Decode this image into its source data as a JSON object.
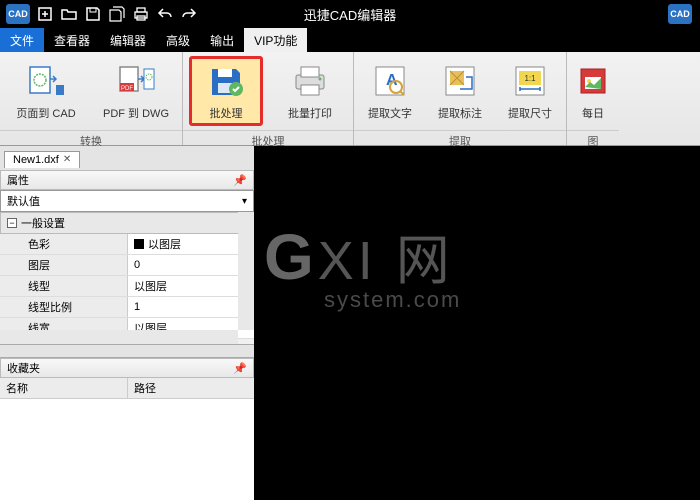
{
  "app": {
    "title": "迅捷CAD编辑器",
    "logo_text": "CAD"
  },
  "menu": {
    "items": [
      "文件",
      "查看器",
      "编辑器",
      "高级",
      "输出",
      "VIP功能"
    ],
    "active_index": 0,
    "vip_index": 5
  },
  "ribbon": {
    "groups": [
      {
        "label": "转换",
        "items": [
          {
            "label": "页面到 CAD"
          },
          {
            "label": "PDF 到 DWG"
          }
        ]
      },
      {
        "label": "批处理",
        "items": [
          {
            "label": "批处理",
            "highlighted": true
          },
          {
            "label": "批量打印"
          }
        ]
      },
      {
        "label": "提取",
        "items": [
          {
            "label": "提取文字"
          },
          {
            "label": "提取标注"
          },
          {
            "label": "提取尺寸"
          }
        ]
      },
      {
        "label": "图",
        "items": [
          {
            "label": "每日"
          }
        ]
      }
    ]
  },
  "document": {
    "tab_name": "New1.dxf"
  },
  "props_panel": {
    "title": "属性",
    "dropdown": "默认值",
    "section": "一般设置",
    "rows": [
      {
        "key": "色彩",
        "val": "以图层",
        "swatch": true
      },
      {
        "key": "图层",
        "val": "0"
      },
      {
        "key": "线型",
        "val": "以图层"
      },
      {
        "key": "线型比例",
        "val": "1"
      },
      {
        "key": "线宽",
        "val": "以图层"
      }
    ]
  },
  "fav_panel": {
    "title": "收藏夹",
    "cols": [
      "名称",
      "路径"
    ]
  },
  "watermark": {
    "line1_prefix": "G",
    "line1_rest": "XI 网",
    "line2": "system.com"
  }
}
